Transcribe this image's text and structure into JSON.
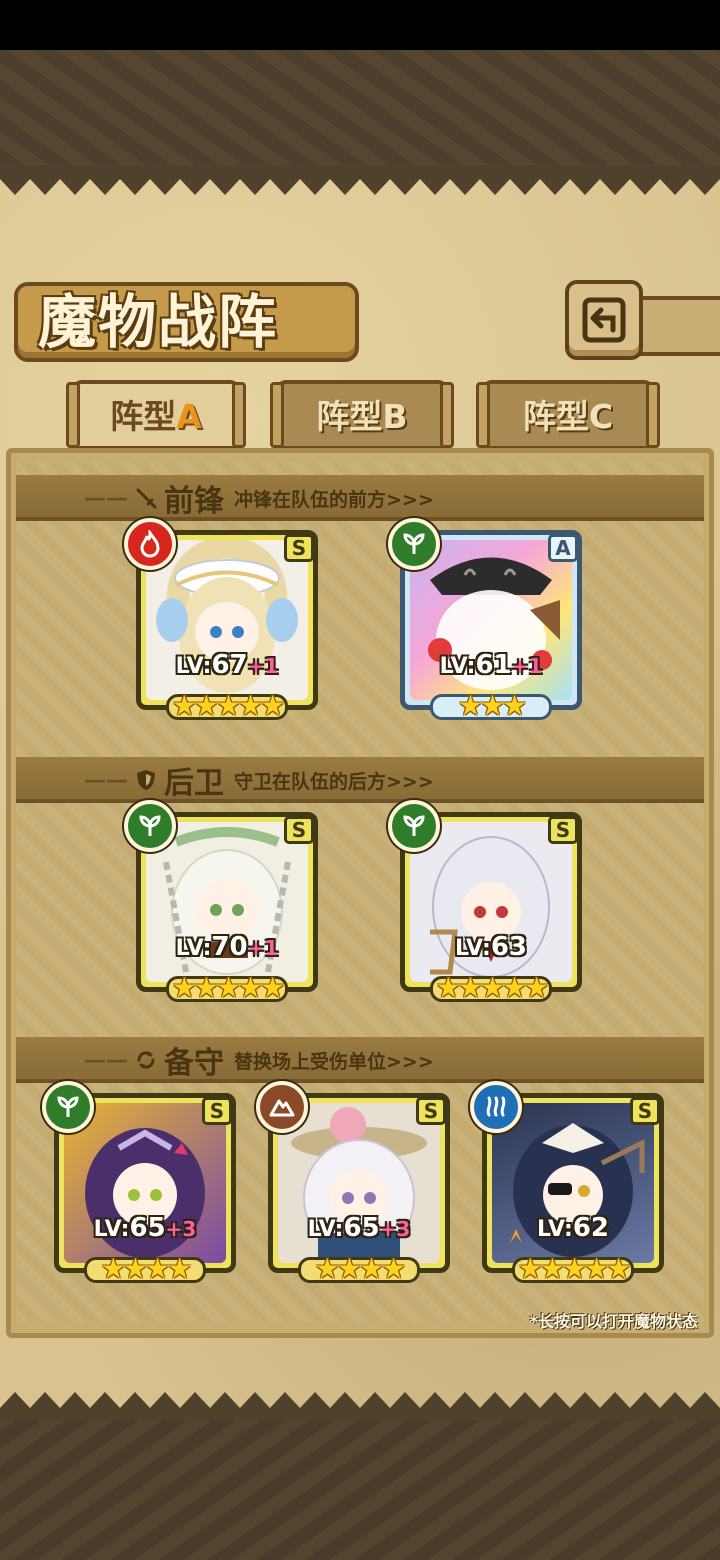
{
  "page": {
    "title": "魔物战阵",
    "hint": "*长按可以打开魔物状态"
  },
  "tabs": [
    {
      "prefix": "阵型",
      "letter": "A",
      "active": true
    },
    {
      "prefix": "阵型",
      "letter": "B",
      "active": false
    },
    {
      "prefix": "阵型",
      "letter": "C",
      "active": false
    }
  ],
  "sections": {
    "vanguard": {
      "title": "前锋",
      "desc": "冲锋在队伍的前方>>>",
      "icon": "sword-icon"
    },
    "rearguard": {
      "title": "后卫",
      "desc": "守卫在队伍的后方>>>",
      "icon": "shield-icon"
    },
    "reserve": {
      "title": "备守",
      "desc": "替换场上受伤单位>>>",
      "icon": "swap-icon"
    }
  },
  "cards": [
    {
      "section": "vanguard",
      "rank": "S",
      "element": "fire",
      "element_color": "#d7261e",
      "level": "67",
      "bonus": "+1",
      "stars": "★★★★★",
      "star_count": 5,
      "art": "white-hair-girl-white-hat",
      "frame": "gold"
    },
    {
      "section": "vanguard",
      "rank": "A",
      "element": "nature",
      "element_color": "#2f7d2a",
      "level": "61",
      "bonus": "+1",
      "stars": "★★★",
      "star_count": 3,
      "art": "rainbow-candy-monster-black-hat",
      "frame": "silver"
    },
    {
      "section": "rearguard",
      "rank": "S",
      "element": "nature",
      "element_color": "#2f7d2a",
      "level": "70",
      "bonus": "+1",
      "stars": "★★★★★",
      "star_count": 5,
      "art": "white-hair-girl-laurel-chains",
      "frame": "gold"
    },
    {
      "section": "rearguard",
      "rank": "S",
      "element": "nature",
      "element_color": "#2f7d2a",
      "level": "63",
      "bonus": "",
      "stars": "★★★★★",
      "star_count": 5,
      "art": "silver-hair-girl-harp",
      "frame": "gold"
    },
    {
      "section": "reserve",
      "rank": "S",
      "element": "nature",
      "element_color": "#2f7d2a",
      "level": "65",
      "bonus": "+3",
      "stars": "★★★★",
      "star_count": 4,
      "art": "purple-hair-girl-tiara",
      "frame": "gold"
    },
    {
      "section": "reserve",
      "rank": "S",
      "element": "earth",
      "element_color": "#8a4a28",
      "level": "65",
      "bonus": "+3",
      "stars": "★★★★",
      "star_count": 4,
      "art": "white-hair-girl-straw-hat",
      "frame": "gold"
    },
    {
      "section": "reserve",
      "rank": "S",
      "element": "water",
      "element_color": "#1f6fb7",
      "level": "62",
      "bonus": "",
      "stars": "★★★★★",
      "star_count": 5,
      "art": "dark-hair-girl-eyepatch",
      "frame": "gold"
    }
  ],
  "labels": {
    "lv_prefix": "LV:"
  },
  "colors": {
    "parchment": "#d8c38f",
    "frame_gold": "#efe25c",
    "frame_silver": "#cfe6f4",
    "bonus_pink": "#ff5fa0",
    "star_yellow": "#ffd21f"
  }
}
